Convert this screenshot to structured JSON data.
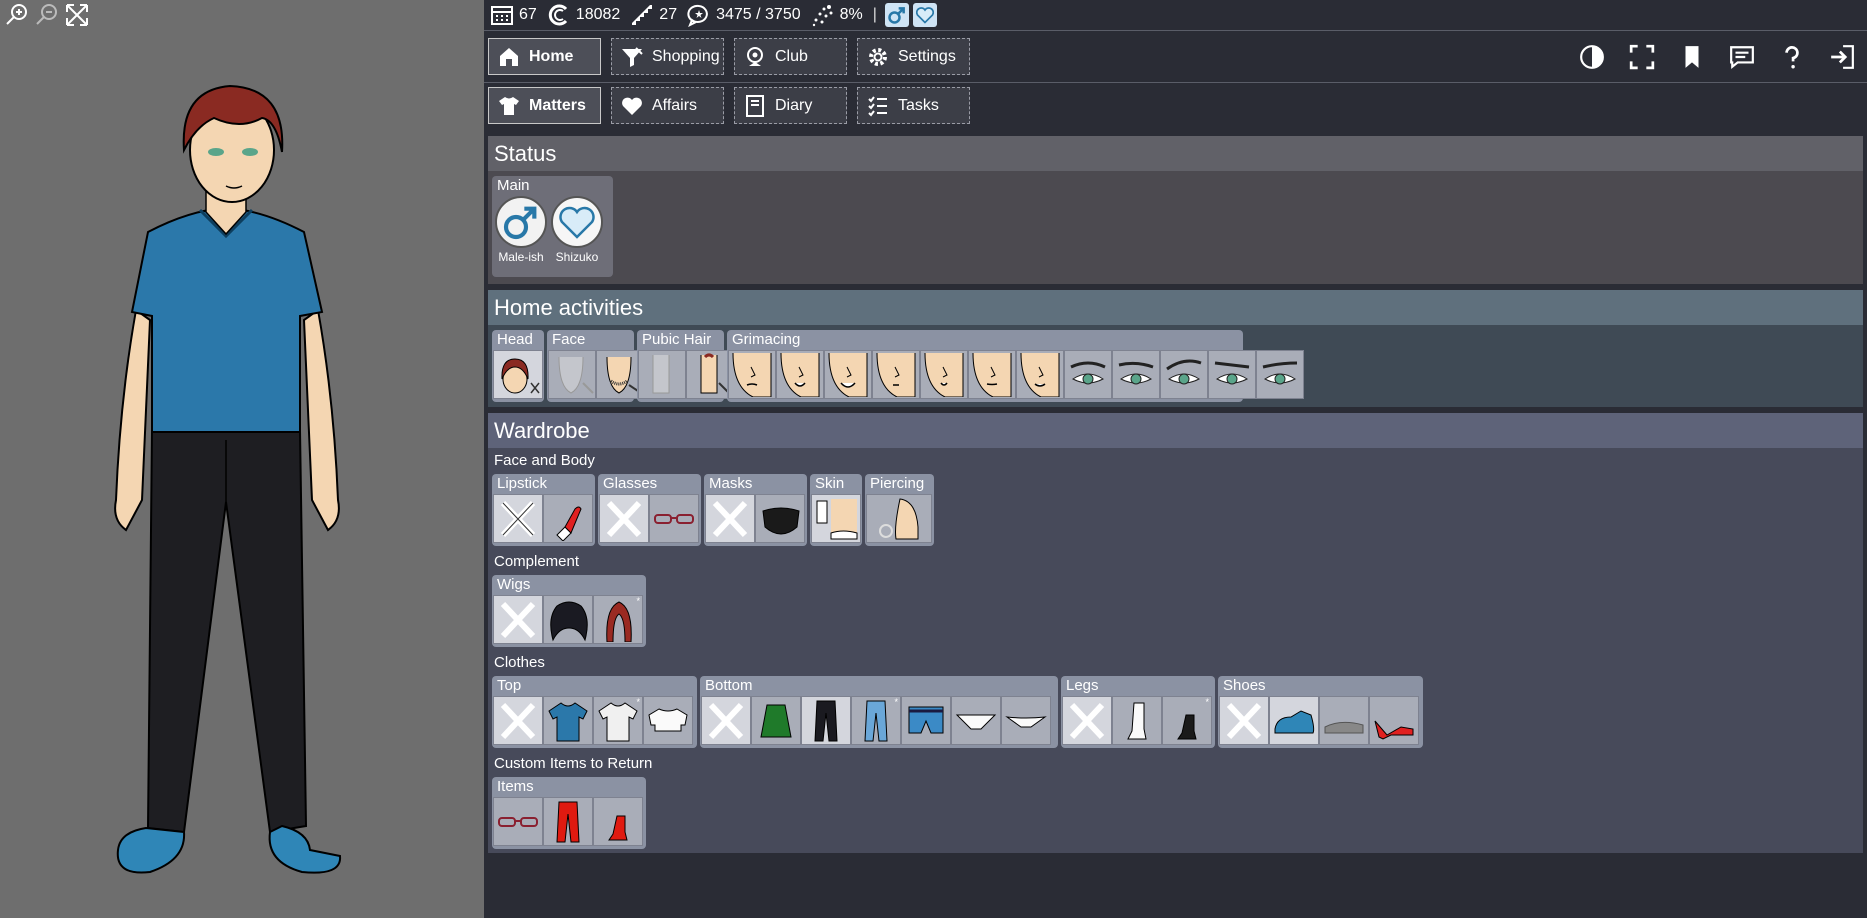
{
  "viewer": {
    "tools": [
      "zoom-in-icon",
      "zoom-out-icon",
      "fit-icon"
    ]
  },
  "stats": {
    "days": "67",
    "money": "18082",
    "stairs": "27",
    "talk": "3475 / 3750",
    "mood": "8%",
    "separator": "|"
  },
  "nav": {
    "row1": [
      {
        "label": "Home",
        "icon": "home-icon",
        "active": true
      },
      {
        "label": "Shopping",
        "icon": "shopping-icon"
      },
      {
        "label": "Club",
        "icon": "webcam-icon"
      },
      {
        "label": "Settings",
        "icon": "gear-icon"
      }
    ],
    "row2": [
      {
        "label": "Matters",
        "icon": "tshirt-icon",
        "active": true
      },
      {
        "label": "Affairs",
        "icon": "heart-icon"
      },
      {
        "label": "Diary",
        "icon": "notebook-icon"
      },
      {
        "label": "Tasks",
        "icon": "checklist-icon"
      }
    ]
  },
  "right_tools": [
    "contrast-icon",
    "fullscreen-icon",
    "bookmark-icon",
    "chat-icon",
    "help-icon",
    "exit-icon"
  ],
  "status": {
    "title": "Status",
    "group": "Main",
    "items": [
      {
        "label": "Male-ish",
        "icon": "male-symbol-icon"
      },
      {
        "label": "Shizuko",
        "icon": "heart-outline-icon"
      }
    ]
  },
  "home": {
    "title": "Home activities",
    "groups": [
      "Head",
      "Face",
      "Pubic Hair",
      "Grimacing"
    ]
  },
  "wardrobe": {
    "title": "Wardrobe",
    "sub_face": "Face and Body",
    "sub_comp": "Complement",
    "sub_clothes": "Clothes",
    "sub_custom": "Custom Items to Return",
    "groups": {
      "lipstick": "Lipstick",
      "glasses": "Glasses",
      "masks": "Masks",
      "skin": "Skin",
      "piercing": "Piercing",
      "wigs": "Wigs",
      "top": "Top",
      "bottom": "Bottom",
      "legs": "Legs",
      "shoes": "Shoes",
      "items": "Items"
    }
  },
  "colors": {
    "status_head": "#616168",
    "home_head": "#5f707d",
    "wardrobe_head": "#5e6379",
    "accent_blue": "#2878a8"
  }
}
